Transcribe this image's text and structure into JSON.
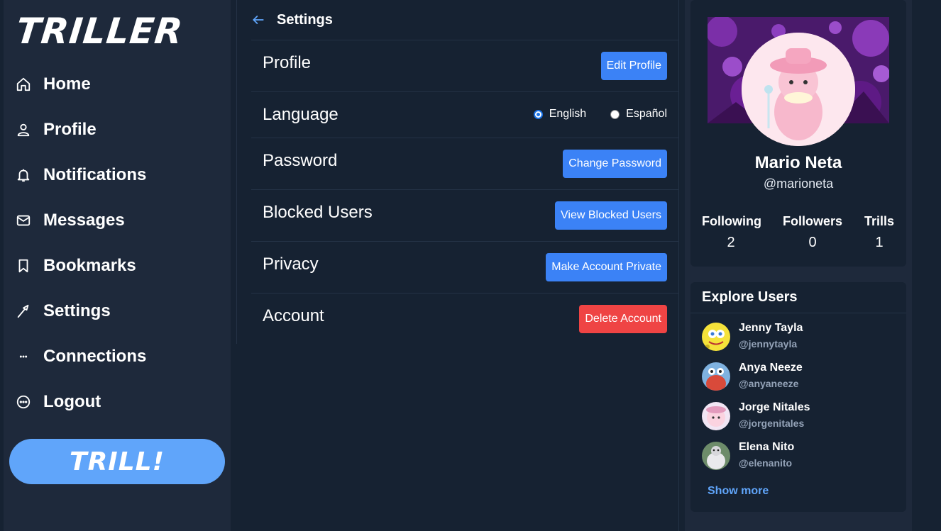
{
  "brand": {
    "logo_text": "TRILLER"
  },
  "sidebar": {
    "items": [
      {
        "label": "Home",
        "icon": "home-icon"
      },
      {
        "label": "Profile",
        "icon": "user-icon"
      },
      {
        "label": "Notifications",
        "icon": "bell-icon"
      },
      {
        "label": "Messages",
        "icon": "mail-icon"
      },
      {
        "label": "Bookmarks",
        "icon": "bookmark-icon"
      },
      {
        "label": "Settings",
        "icon": "pen-icon"
      },
      {
        "label": "Connections",
        "icon": "dots-icon"
      },
      {
        "label": "Logout",
        "icon": "circle-dots-icon"
      }
    ],
    "trill_button": "TRILL!"
  },
  "main": {
    "title": "Settings",
    "settings": [
      {
        "label": "Profile",
        "button": "Edit Profile"
      },
      {
        "label": "Language",
        "options": [
          "English",
          "Español"
        ],
        "selected": "English"
      },
      {
        "label": "Password",
        "button": "Change Password"
      },
      {
        "label": "Blocked Users",
        "button": "View Blocked Users"
      },
      {
        "label": "Privacy",
        "button": "Make Account Private"
      },
      {
        "label": "Account",
        "button": "Delete Account"
      }
    ]
  },
  "profile_card": {
    "name": "Mario Neta",
    "handle": "@marioneta",
    "stats": [
      {
        "label": "Following",
        "value": "2"
      },
      {
        "label": "Followers",
        "value": "0"
      },
      {
        "label": "Trills",
        "value": "1"
      }
    ]
  },
  "explore": {
    "title": "Explore Users",
    "users": [
      {
        "name": "Jenny Tayla",
        "handle": "@jennytayla"
      },
      {
        "name": "Anya Neeze",
        "handle": "@anyaneeze"
      },
      {
        "name": "Jorge Nitales",
        "handle": "@jorgenitales"
      },
      {
        "name": "Elena Nito",
        "handle": "@elenanito"
      }
    ],
    "show_more": "Show more"
  },
  "colors": {
    "background": "#162232",
    "panel": "#1e293b",
    "primary_button": "#3b82f6",
    "danger_button": "#ef4444",
    "accent": "#60a5fa"
  }
}
